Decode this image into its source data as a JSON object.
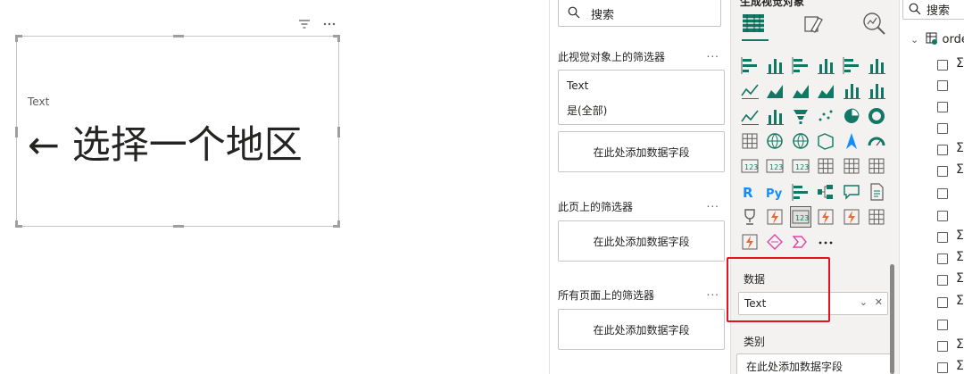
{
  "canvas": {
    "card": {
      "label": "Text",
      "value": "← 选择一个地区"
    },
    "icons": [
      "filter-icon",
      "more-options-icon"
    ]
  },
  "filters": {
    "search_placeholder": "搜索",
    "visual_section_title": "此视觉对象上的筛选器",
    "visual_filter": {
      "field": "Text",
      "value": "是(全部)"
    },
    "add_field_label": "在此处添加数据字段",
    "page_section_title": "此页上的筛选器",
    "all_pages_section_title": "所有页面上的筛选器",
    "more": "..."
  },
  "visualizations": {
    "title": "生成视觉对象",
    "tabs": [
      "build-visual-icon",
      "format-visual-icon",
      "analytics-icon"
    ],
    "icon_names": [
      "stacked-bar-icon",
      "stacked-column-icon",
      "clustered-bar-icon",
      "clustered-column-icon",
      "100-bar-icon",
      "100-column-icon",
      "line-chart-icon",
      "area-chart-icon",
      "stacked-area-icon",
      "100-area-icon",
      "line-column-icon",
      "line-clustered-icon",
      "ribbon-chart-icon",
      "waterfall-icon",
      "funnel-icon",
      "scatter-icon",
      "pie-icon",
      "donut-icon",
      "treemap-icon",
      "map-icon",
      "filled-map-icon",
      "shape-map-icon",
      "azure-map-icon",
      "gauge-icon",
      "card-icon",
      "multirow-card-icon",
      "kpi-icon",
      "slicer-icon",
      "table-icon",
      "matrix-icon",
      "r-visual-icon",
      "python-visual-icon",
      "key-influencers-icon",
      "decomposition-tree-icon",
      "qa-icon",
      "narrative-icon",
      "goals-icon",
      "paginated-report-icon",
      "new-card-icon",
      "power-apps-icon",
      "power-automate-icon",
      "new-slicer-icon",
      "arcgis-icon",
      "custom-visual-icon",
      "power-automate-2-icon",
      "more-visuals-icon"
    ],
    "more_visuals": "...",
    "data_well_label": "数据",
    "data_field": "Text",
    "category_well_label": "类别",
    "add_field_label": "在此处添加数据字段",
    "colors": {
      "accent": "#117865",
      "highlight": "#e81123"
    }
  },
  "data_pane": {
    "search_placeholder": "搜索",
    "table_name": "order",
    "sigma": "Σ"
  }
}
